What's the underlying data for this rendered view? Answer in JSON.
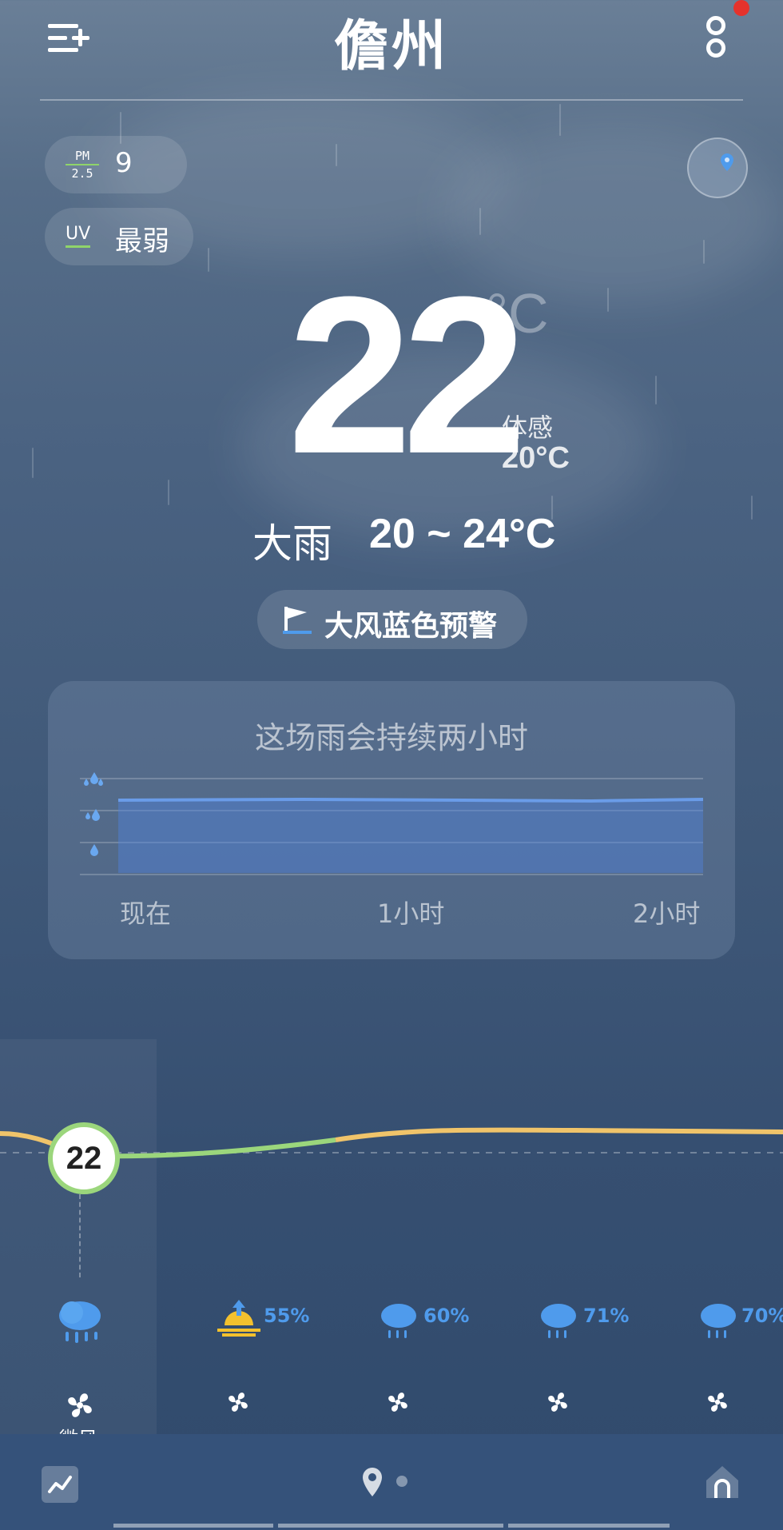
{
  "header": {
    "city": "儋州"
  },
  "air": {
    "pm_label_top": "PM",
    "pm_label_bottom": "2.5",
    "pm_value": "9",
    "uv_label": "UV",
    "uv_value": "最弱"
  },
  "current": {
    "temperature": "22",
    "unit": "°C",
    "feels_like_label": "体感",
    "feels_like": "20°C",
    "condition": "大雨",
    "range": "20 ~ 24°C"
  },
  "alert": {
    "text": "大风蓝色预警"
  },
  "rain_card": {
    "title": "这场雨会持续两小时",
    "time_labels": [
      "现在",
      "1小时",
      "2小时"
    ]
  },
  "hourly": {
    "current_temp": "22",
    "items": [
      {
        "icon": "heavy-rain-cloud-icon",
        "pct": ""
      },
      {
        "icon": "sunrise-icon",
        "pct": "55%"
      },
      {
        "icon": "rain-cloud-icon",
        "pct": "60%"
      },
      {
        "icon": "rain-cloud-icon",
        "pct": "71%"
      },
      {
        "icon": "rain-cloud-icon",
        "pct": "70%"
      }
    ],
    "wind_label": "微风"
  },
  "colors": {
    "alert_blue": "#4f9bec",
    "pm_green": "#8fd46a",
    "temp_line_yellow": "#f0c46a",
    "temp_line_green": "#9bd67c",
    "notification_red": "#e5322c"
  }
}
